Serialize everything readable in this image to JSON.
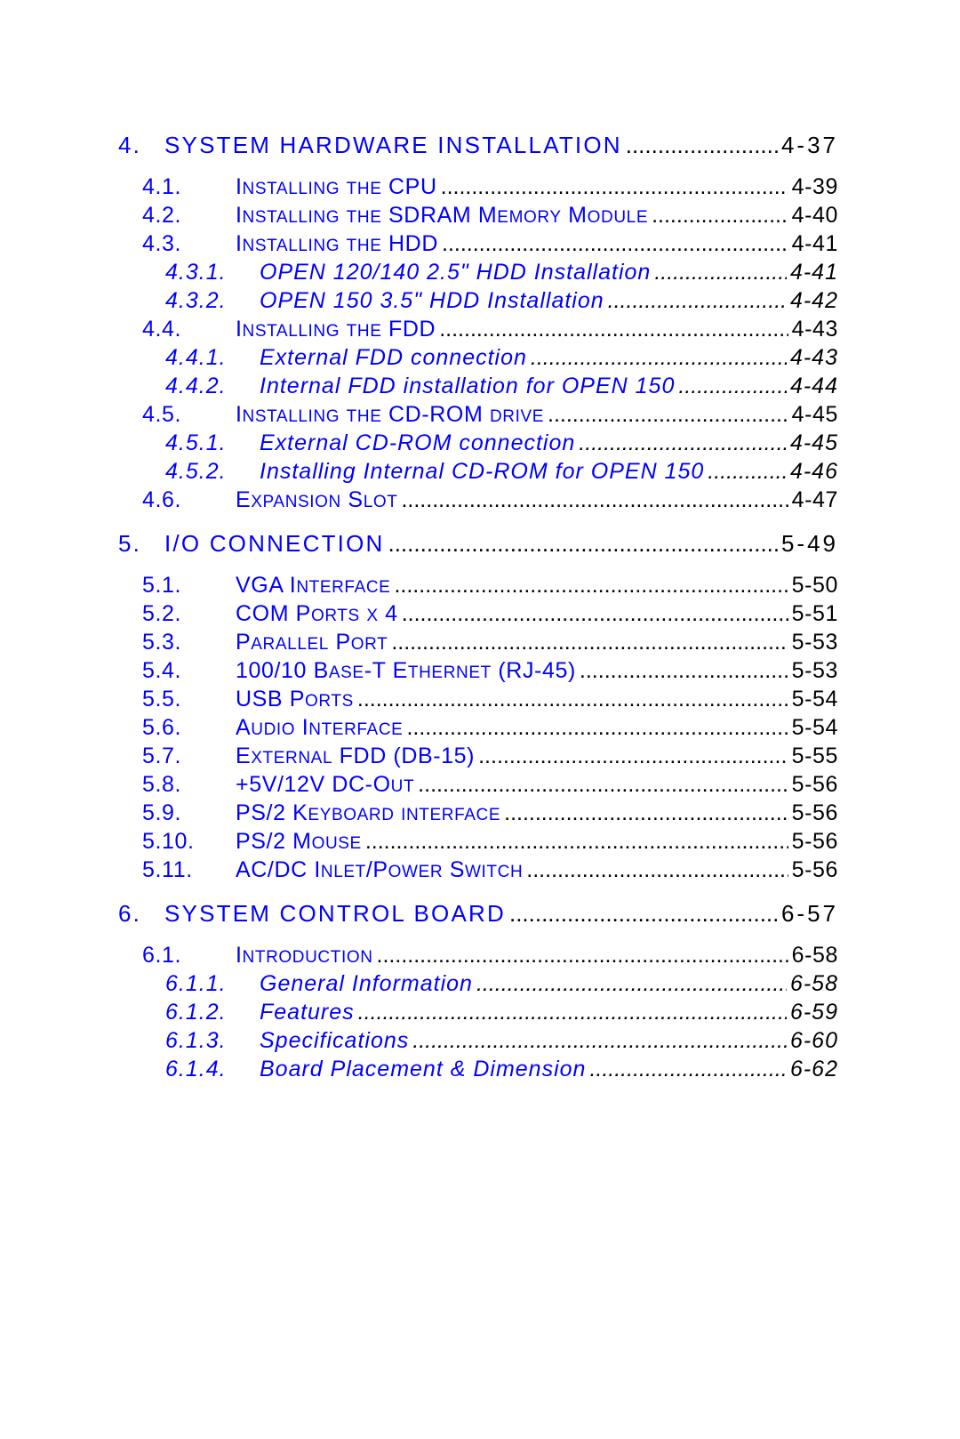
{
  "colors": {
    "link": "#0000ff",
    "page_number": "#000000"
  },
  "toc": [
    {
      "level": 1,
      "num": "4.",
      "title": "SYSTEM HARDWARE INSTALLATION",
      "page": "4-37"
    },
    {
      "level": 2,
      "num": "4.1.",
      "title": "Installing the CPU",
      "page": "4-39"
    },
    {
      "level": 2,
      "num": "4.2.",
      "title": "Installing the SDRAM Memory Module",
      "page": "4-40"
    },
    {
      "level": 2,
      "num": "4.3.",
      "title": "Installing the HDD",
      "page": "4-41"
    },
    {
      "level": 3,
      "num": "4.3.1.",
      "title": "OPEN 120/140 2.5\" HDD Installation",
      "page": "4-41"
    },
    {
      "level": 3,
      "num": "4.3.2.",
      "title": "OPEN  150 3.5\" HDD Installation",
      "page": "4-42"
    },
    {
      "level": 2,
      "num": "4.4.",
      "title": "Installing the FDD",
      "page": "4-43"
    },
    {
      "level": 3,
      "num": "4.4.1.",
      "title": "External FDD connection",
      "page": "4-43"
    },
    {
      "level": 3,
      "num": "4.4.2.",
      "title": "Internal FDD installation for OPEN 150",
      "page": "4-44"
    },
    {
      "level": 2,
      "num": "4.5.",
      "title": "Installing the CD-ROM drive",
      "page": "4-45"
    },
    {
      "level": 3,
      "num": "4.5.1.",
      "title": "External CD-ROM connection",
      "page": "4-45"
    },
    {
      "level": 3,
      "num": "4.5.2.",
      "title": "Installing Internal CD-ROM for OPEN 150",
      "page": "4-46"
    },
    {
      "level": 2,
      "num": "4.6.",
      "title": "Expansion Slot",
      "page": "4-47"
    },
    {
      "level": 1,
      "num": "5.",
      "title": "I/O CONNECTION",
      "page": "5-49"
    },
    {
      "level": 2,
      "num": "5.1.",
      "title": "VGA Interface",
      "page": "5-50"
    },
    {
      "level": 2,
      "num": "5.2.",
      "title": "COM Ports x 4",
      "page": "5-51"
    },
    {
      "level": 2,
      "num": "5.3.",
      "title": "Parallel Port",
      "page": "5-53"
    },
    {
      "level": 2,
      "num": "5.4.",
      "title": "100/10 Base-T Ethernet (RJ-45)",
      "page": "5-53"
    },
    {
      "level": 2,
      "num": "5.5.",
      "title": "USB Ports",
      "page": "5-54"
    },
    {
      "level": 2,
      "num": "5.6.",
      "title": "Audio Interface",
      "page": "5-54"
    },
    {
      "level": 2,
      "num": "5.7.",
      "title": "External FDD (DB-15)",
      "page": "5-55"
    },
    {
      "level": 2,
      "num": "5.8.",
      "title": "+5V/12V DC-Out",
      "page": "5-56"
    },
    {
      "level": 2,
      "num": "5.9.",
      "title": "PS/2 Keyboard interface",
      "page": "5-56"
    },
    {
      "level": 2,
      "num": "5.10.",
      "title": "PS/2 Mouse",
      "page": "5-56"
    },
    {
      "level": 2,
      "num": "5.11.",
      "title": "AC/DC Inlet/Power Switch",
      "page": "5-56"
    },
    {
      "level": 1,
      "num": "6.",
      "title": "SYSTEM CONTROL BOARD",
      "page": "6-57"
    },
    {
      "level": 2,
      "num": "6.1.",
      "title": "Introduction",
      "page": "6-58"
    },
    {
      "level": 3,
      "num": "6.1.1.",
      "title": "General Information",
      "page": "6-58"
    },
    {
      "level": 3,
      "num": "6.1.2.",
      "title": "Features",
      "page": "6-59"
    },
    {
      "level": 3,
      "num": "6.1.3.",
      "title": "Specifications",
      "page": "6-60"
    },
    {
      "level": 3,
      "num": "6.1.4.",
      "title": "Board Placement & Dimension",
      "page": "6-62"
    }
  ]
}
